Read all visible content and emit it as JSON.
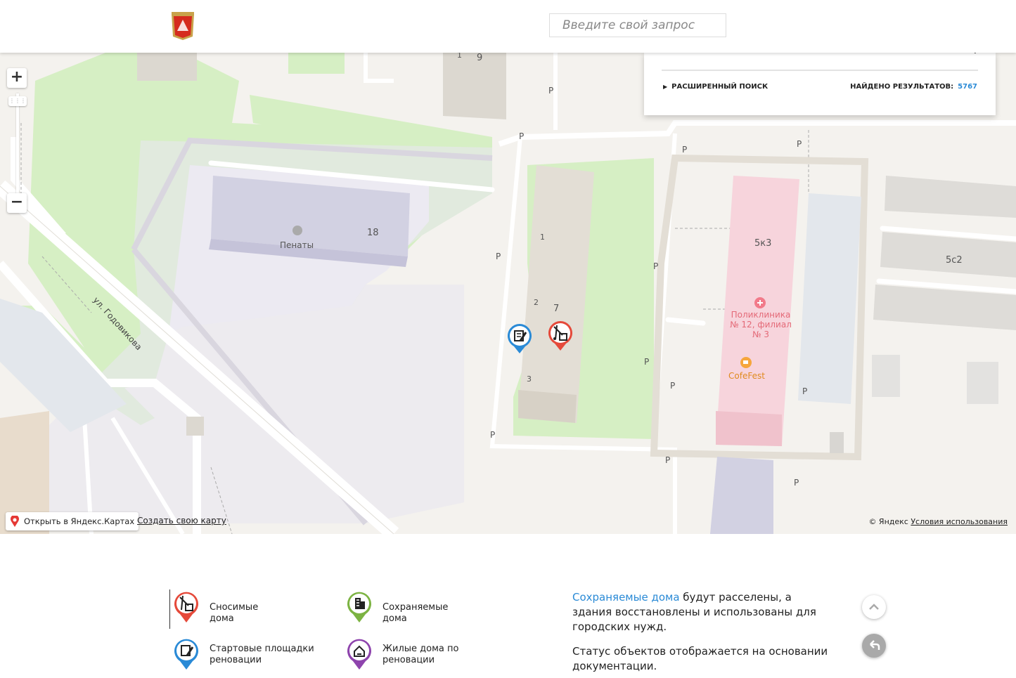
{
  "header": {
    "search_placeholder": "Введите свой запрос"
  },
  "search_panel": {
    "advanced_search": "РАСШИРЕННЫЙ ПОИСК",
    "found_label": "НАЙДЕНО РЕЗУЛЬТАТОВ:",
    "found_count": "5767"
  },
  "map": {
    "zoom_in": "+",
    "zoom_out": "−",
    "open_yandex": "Открыть в Яндекс.Картах",
    "create_map": "Создать свою карту",
    "copyright": "© Яндекс",
    "terms": "Условия использования",
    "labels": {
      "penaty": "Пенаты",
      "b18": "18",
      "b9": "9",
      "b1": "1",
      "b7": "7",
      "e1": "1",
      "e2": "2",
      "e3": "3",
      "b5k3": "5к3",
      "b5c2": "5с2",
      "street": "ул. Годовикова",
      "clinic": "Поликлиника № 12, филиал № 3",
      "cafe": "CofeFest",
      "parking": "P"
    }
  },
  "legend": {
    "demolished": "Сносимые дома",
    "preserved": "Сохраняемые дома",
    "starting": "Стартовые площадки реновации",
    "residential": "Жилые дома по реновации",
    "desc_highlight": "Сохраняемые дома",
    "desc_rest": " будут расселены, а здания восстановлены и использованы для городских нужд.",
    "status_text": "Статус объектов отображается на основании документации."
  },
  "colors": {
    "accent_blue": "#2a8ad6",
    "red_marker": "#e5493a",
    "blue_marker": "#2a8ad6",
    "green_marker": "#7cb342",
    "purple_marker": "#8e44ad"
  }
}
